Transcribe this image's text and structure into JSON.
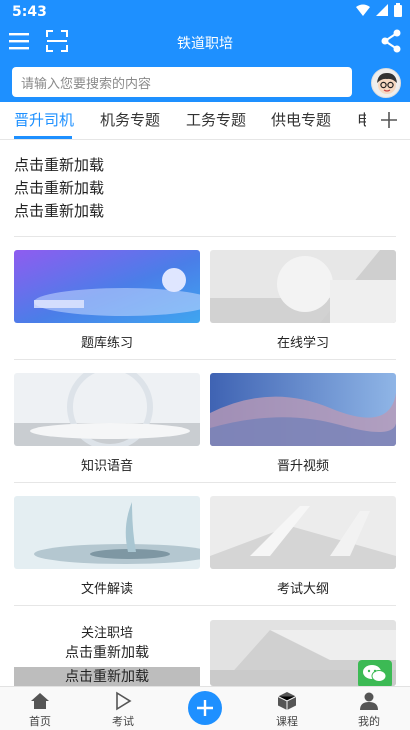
{
  "status_bar": {
    "time": "5:43"
  },
  "app_bar": {
    "title": "铁道职培"
  },
  "search": {
    "placeholder": "请输入您要搜索的内容"
  },
  "tabs": [
    {
      "label": "晋升司机",
      "active": true
    },
    {
      "label": "机务专题"
    },
    {
      "label": "工务专题"
    },
    {
      "label": "供电专题"
    },
    {
      "label": "电"
    }
  ],
  "notices": [
    "点击重新加载",
    "点击重新加载",
    "点击重新加载"
  ],
  "cards": [
    {
      "label": "题库练习"
    },
    {
      "label": "在线学习"
    },
    {
      "label": "知识语音"
    },
    {
      "label": "晋升视频"
    },
    {
      "label": "文件解读"
    },
    {
      "label": "考试大纲"
    }
  ],
  "promo": {
    "title": "关注职培",
    "reload_1": "点击重新加载",
    "reload_2": "点击重新加载"
  },
  "bottom_nav": [
    {
      "label": "首页",
      "icon": "home-icon"
    },
    {
      "label": "考试",
      "icon": "play-icon"
    },
    {
      "label": "",
      "icon": "add-icon"
    },
    {
      "label": "课程",
      "icon": "cube-icon"
    },
    {
      "label": "我的",
      "icon": "person-icon"
    }
  ],
  "colors": {
    "primary": "#1e90ff",
    "wechat": "#3cba54"
  }
}
